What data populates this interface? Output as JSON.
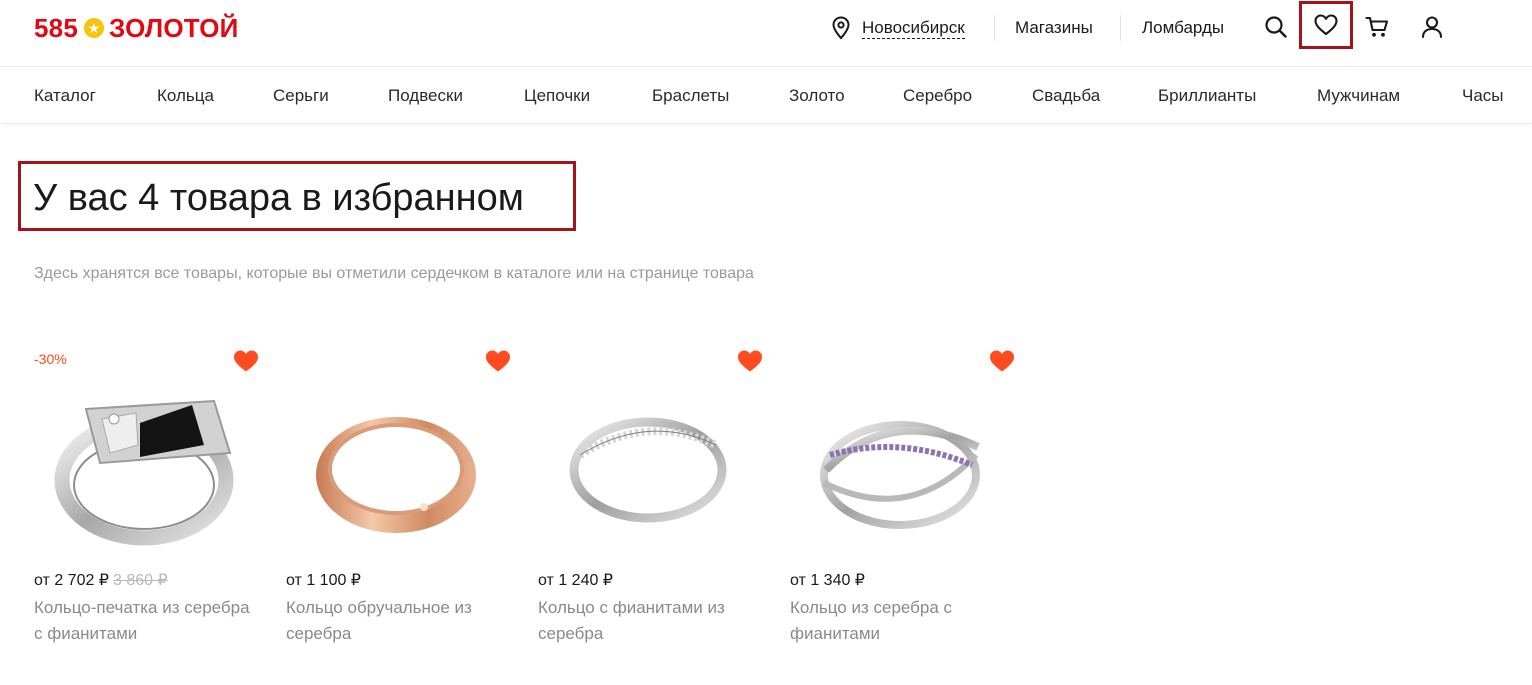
{
  "brand": {
    "number": "585",
    "name": "ЗОЛОТОЙ"
  },
  "header": {
    "city": "Новосибирск",
    "links": [
      "Магазины",
      "Ломбарды"
    ]
  },
  "nav": [
    "Каталог",
    "Кольца",
    "Серьги",
    "Подвески",
    "Цепочки",
    "Браслеты",
    "Золото",
    "Серебро",
    "Свадьба",
    "Бриллианты",
    "Мужчинам",
    "Часы"
  ],
  "favorites": {
    "title": "У вас 4 товара в избранном",
    "subtitle": "Здесь хранятся все товары, которые вы отметили сердечком в каталоге или на странице товара"
  },
  "products": [
    {
      "discount": "-30%",
      "price": "от 2 702 ₽",
      "old_price": "3 860 ₽",
      "name": "Кольцо-печатка из серебра с фианитами",
      "image": "silver-signet-ring"
    },
    {
      "discount": "",
      "price": "от 1 100 ₽",
      "old_price": "",
      "name": "Кольцо обручальное из серебра",
      "image": "gilded-wedding-band"
    },
    {
      "discount": "",
      "price": "от 1 240 ₽",
      "old_price": "",
      "name": "Кольцо с фианитами из серебра",
      "image": "thin-silver-ring-with-stones"
    },
    {
      "discount": "",
      "price": "от 1 340 ₽",
      "old_price": "",
      "name": "Кольцо из серебра с фианитами",
      "image": "crossover-silver-ring-with-purple-stones"
    }
  ],
  "colors": {
    "brand_red": "#e30613",
    "accent_orange": "#ff4b1f",
    "highlight": "#a3131a"
  }
}
